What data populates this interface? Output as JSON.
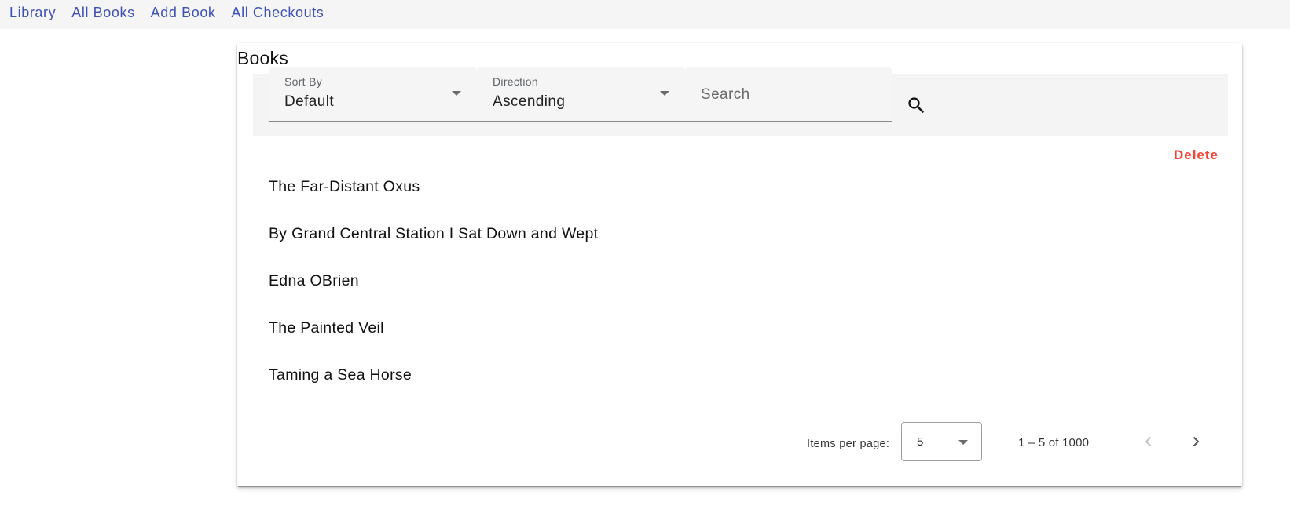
{
  "nav": {
    "items": [
      "Library",
      "All Books",
      "Add Book",
      "All Checkouts"
    ]
  },
  "card": {
    "title": "Books"
  },
  "filters": {
    "sort_label": "Sort By",
    "sort_value": "Default",
    "direction_label": "Direction",
    "direction_value": "Ascending",
    "search_placeholder": "Search",
    "search_icon": "search-icon"
  },
  "actions": {
    "delete_label": "Delete"
  },
  "books": [
    "The Far-Distant Oxus",
    "By Grand Central Station I Sat Down and Wept",
    "Edna OBrien",
    "The Painted Veil",
    "Taming a Sea Horse"
  ],
  "paginator": {
    "items_per_page_label": "Items per page:",
    "page_size": "5",
    "range_label": "1 – 5 of 1000",
    "prev_icon": "chevron-left-icon",
    "next_icon": "chevron-right-icon"
  },
  "colors": {
    "nav_link": "#3f51b5",
    "delete": "#f44336",
    "filter_bg": "#f4f4f4"
  }
}
